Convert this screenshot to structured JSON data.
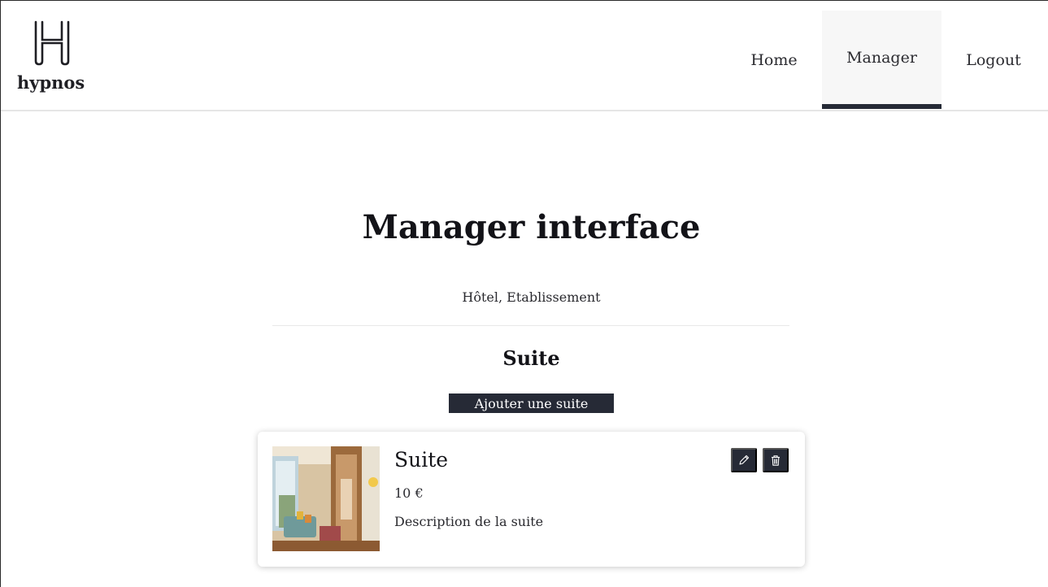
{
  "brand": {
    "logo_text": "hypnos"
  },
  "nav": {
    "items": [
      {
        "label": "Home",
        "active": false
      },
      {
        "label": "Manager",
        "active": true
      },
      {
        "label": "Logout",
        "active": false
      }
    ]
  },
  "main": {
    "title": "Manager interface",
    "subtitle": "Hôtel, Etablissement",
    "section_title": "Suite",
    "add_button_label": "Ajouter une suite"
  },
  "suites": [
    {
      "name": "Suite",
      "price": "10 €",
      "description": "Description de la suite",
      "actions": [
        {
          "icon": "pencil-icon"
        },
        {
          "icon": "trash-icon"
        }
      ]
    }
  ],
  "colors": {
    "accent_dark": "#262a36",
    "active_tab_bg": "#f7f7f7"
  }
}
